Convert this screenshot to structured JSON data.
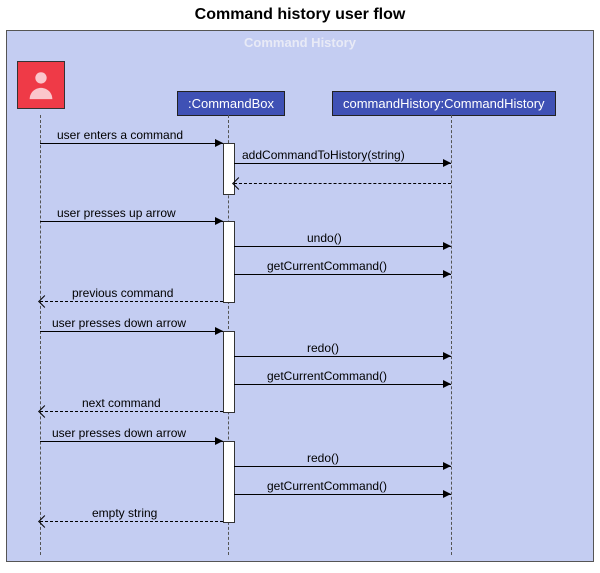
{
  "title": "Command history user flow",
  "frame_label": "Command History",
  "participants": {
    "p1": ":CommandBox",
    "p2": "commandHistory:CommandHistory"
  },
  "messages": {
    "m1": "user enters a command",
    "m2": "addCommandToHistory(string)",
    "m3": "user presses up arrow",
    "m4": "undo()",
    "m5": "getCurrentCommand()",
    "m6": "previous command",
    "m7": "user presses down arrow",
    "m8": "redo()",
    "m9": "getCurrentCommand()",
    "m10": "next command",
    "m11": "user presses down arrow",
    "m12": "redo()",
    "m13": "getCurrentCommand()",
    "m14": "empty string"
  },
  "chart_data": {
    "type": "sequence_diagram",
    "title": "Command history user flow",
    "frame": "Command History",
    "participants": [
      {
        "id": "user",
        "type": "actor"
      },
      {
        "id": "cb",
        "label": ":CommandBox"
      },
      {
        "id": "ch",
        "label": "commandHistory:CommandHistory"
      }
    ],
    "messages": [
      {
        "from": "user",
        "to": "cb",
        "label": "user enters a command",
        "kind": "sync"
      },
      {
        "from": "cb",
        "to": "ch",
        "label": "addCommandToHistory(string)",
        "kind": "sync"
      },
      {
        "from": "ch",
        "to": "cb",
        "label": "",
        "kind": "return"
      },
      {
        "from": "user",
        "to": "cb",
        "label": "user presses up arrow",
        "kind": "sync"
      },
      {
        "from": "cb",
        "to": "ch",
        "label": "undo()",
        "kind": "sync"
      },
      {
        "from": "cb",
        "to": "ch",
        "label": "getCurrentCommand()",
        "kind": "sync"
      },
      {
        "from": "cb",
        "to": "user",
        "label": "previous command",
        "kind": "return"
      },
      {
        "from": "user",
        "to": "cb",
        "label": "user presses down arrow",
        "kind": "sync"
      },
      {
        "from": "cb",
        "to": "ch",
        "label": "redo()",
        "kind": "sync"
      },
      {
        "from": "cb",
        "to": "ch",
        "label": "getCurrentCommand()",
        "kind": "sync"
      },
      {
        "from": "cb",
        "to": "user",
        "label": "next command",
        "kind": "return"
      },
      {
        "from": "user",
        "to": "cb",
        "label": "user presses down arrow",
        "kind": "sync"
      },
      {
        "from": "cb",
        "to": "ch",
        "label": "redo()",
        "kind": "sync"
      },
      {
        "from": "cb",
        "to": "ch",
        "label": "getCurrentCommand()",
        "kind": "sync"
      },
      {
        "from": "cb",
        "to": "user",
        "label": "empty string",
        "kind": "return"
      }
    ]
  }
}
